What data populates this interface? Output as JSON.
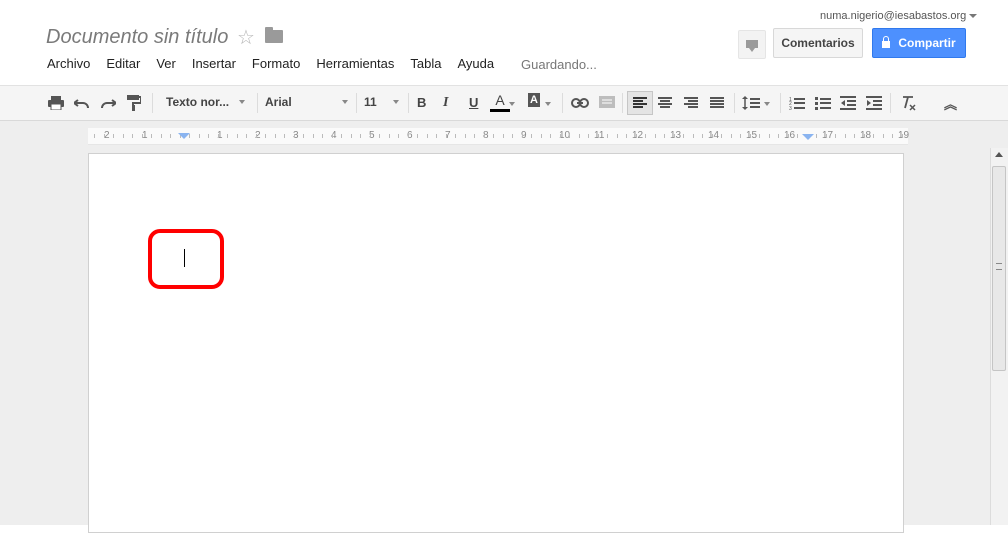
{
  "document": {
    "title": "Documento sin título",
    "save_status": "Guardando..."
  },
  "header": {
    "user_email": "numa.nigerio@iesabastos.org",
    "comments_label": "Comentarios",
    "share_label": "Compartir",
    "star_glyph": "☆"
  },
  "menu": {
    "items": [
      "Archivo",
      "Editar",
      "Ver",
      "Insertar",
      "Formato",
      "Herramientas",
      "Tabla",
      "Ayuda"
    ]
  },
  "toolbar": {
    "style": "Texto nor...",
    "font": "Arial",
    "size": "11",
    "bold": "B",
    "italic": "I",
    "underline": "U",
    "text_color": "A",
    "highlight": "A",
    "collapse": "︽"
  },
  "ruler": {
    "labels": [
      "2",
      "1",
      "",
      "1",
      "2",
      "3",
      "4",
      "5",
      "6",
      "7",
      "8",
      "9",
      "10",
      "11",
      "12",
      "13",
      "14",
      "15",
      "16",
      "17",
      "18",
      "19"
    ]
  },
  "colors": {
    "accent": "#4d90fe",
    "highlight_outline": "#ff0000"
  }
}
